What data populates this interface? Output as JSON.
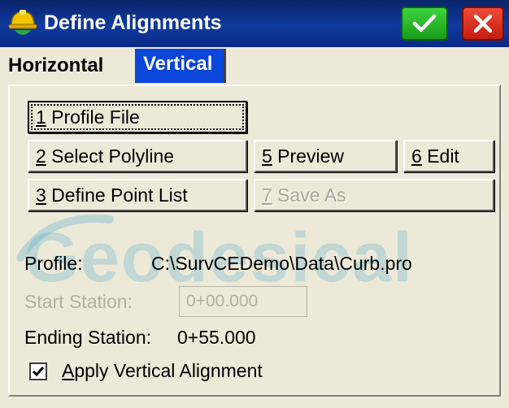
{
  "window": {
    "title": "Define Alignments"
  },
  "tabs": {
    "horizontal": "Horizontal",
    "vertical": "Vertical",
    "active": "Vertical"
  },
  "buttons": {
    "profile_file": {
      "key": "1",
      "label": " Profile File"
    },
    "select_polyline": {
      "key": "2",
      "label": " Select Polyline"
    },
    "define_point_list": {
      "key": "3",
      "label": " Define Point List"
    },
    "preview": {
      "key": "5",
      "label": " Preview"
    },
    "edit": {
      "key": "6",
      "label": " Edit"
    },
    "save_as": {
      "key": "7",
      "label": " Save As",
      "enabled": false
    }
  },
  "watermark": "Geodesical",
  "profile": {
    "label": "Profile:",
    "value": "C:\\SurvCEDemo\\Data\\Curb.pro"
  },
  "start_station": {
    "label": "Start Station:",
    "value": "0+00.000",
    "enabled": false
  },
  "ending_station": {
    "label": "Ending Station:",
    "value": "0+55.000"
  },
  "apply_vertical": {
    "key": "A",
    "label": "pply Vertical Alignment",
    "checked": true
  },
  "colors": {
    "title_bar": "#0a246a",
    "active_tab": "#0a46d8",
    "ok": "#1a9c1a",
    "close": "#c41c10",
    "face": "#ece9d8"
  },
  "icons": {
    "app": "hardhat-icon",
    "ok": "check-icon",
    "close": "close-icon"
  }
}
